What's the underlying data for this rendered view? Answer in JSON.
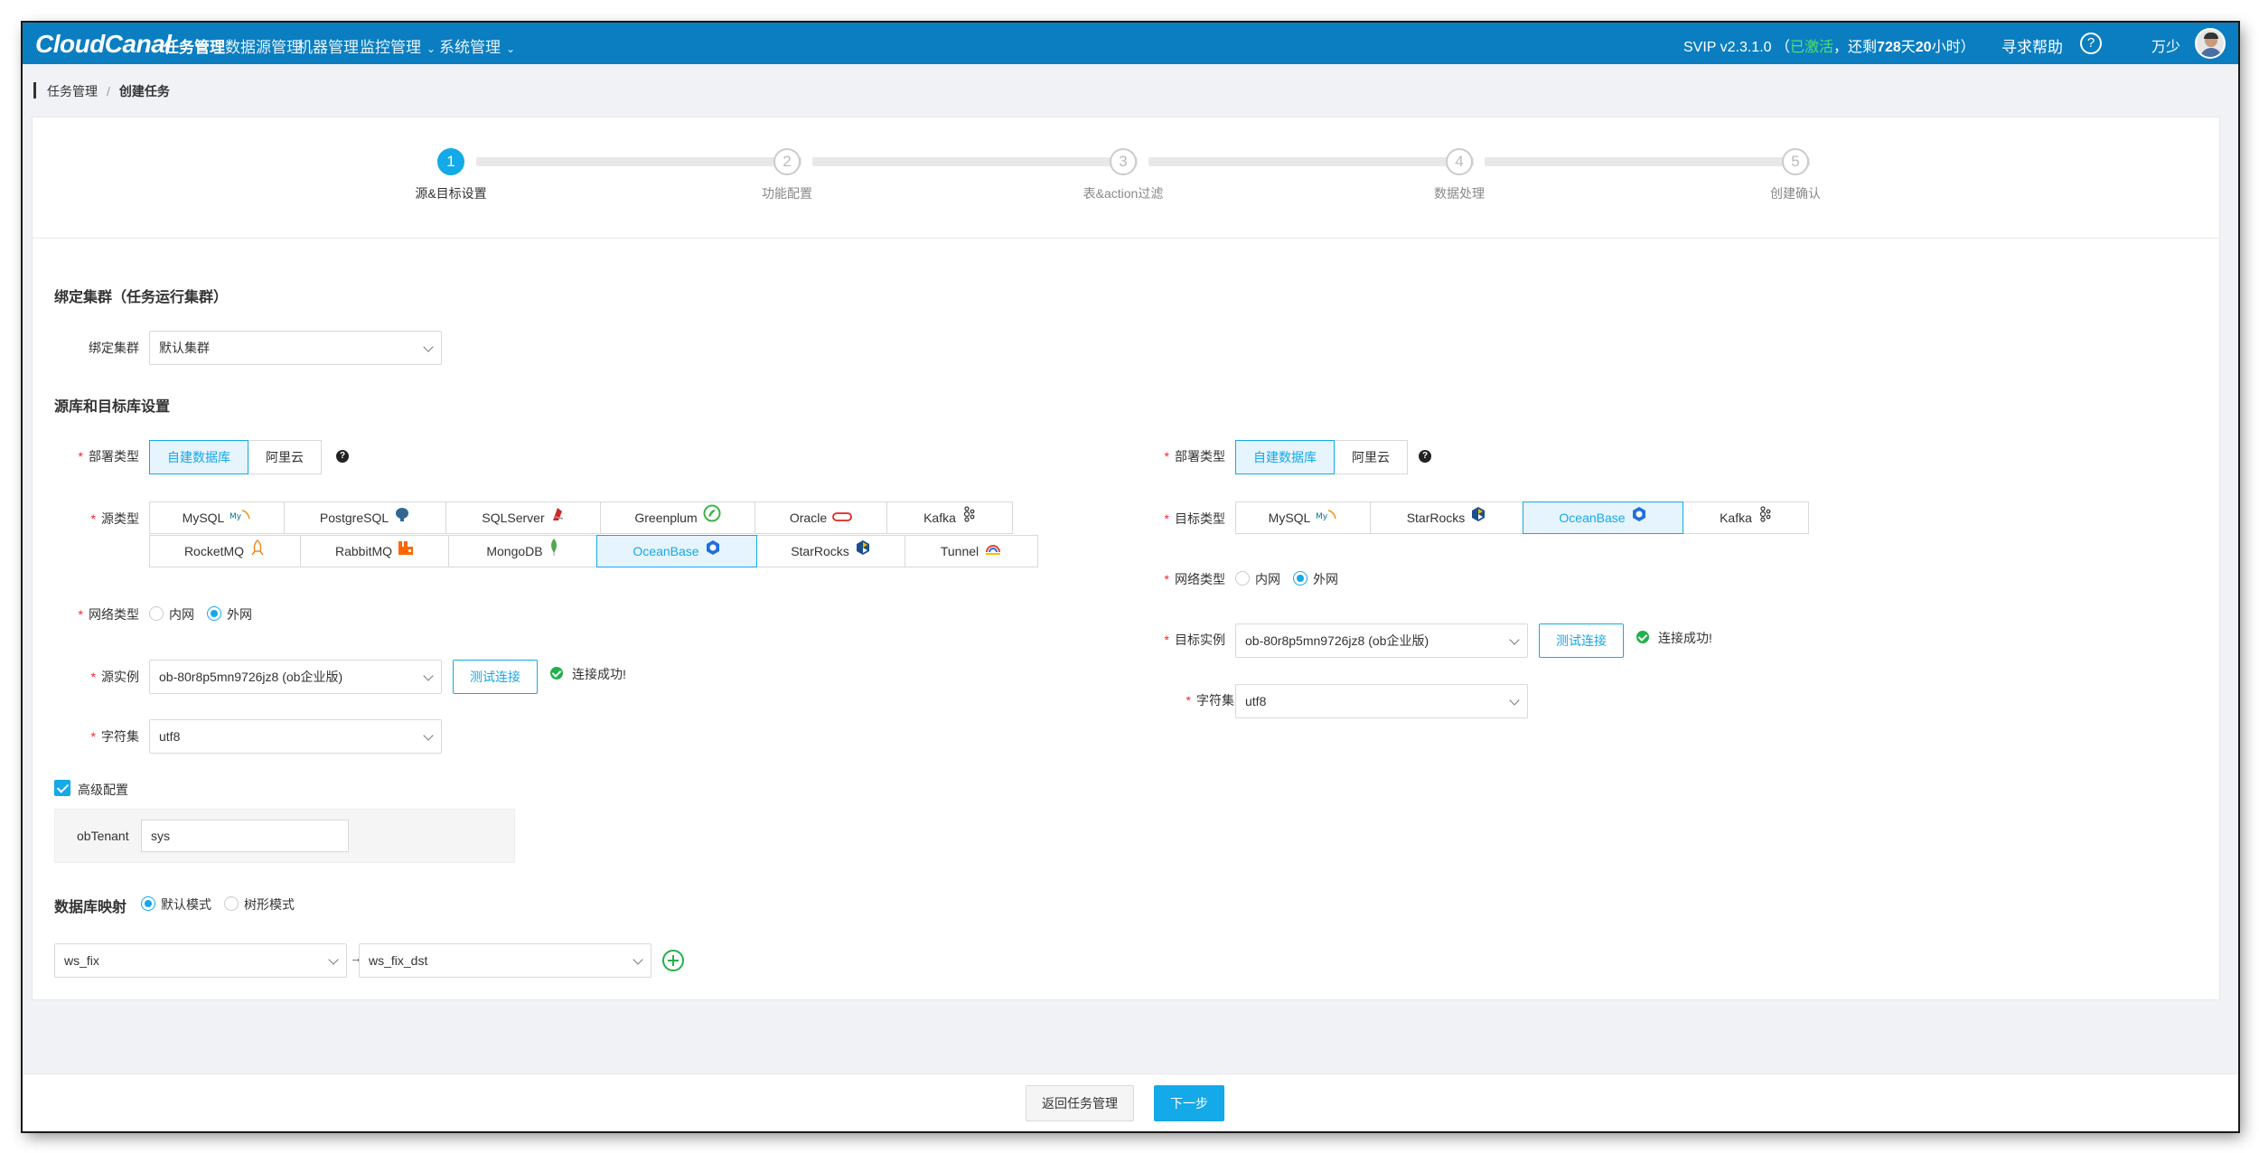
{
  "app": {
    "logo": "CloudCanal",
    "nav": [
      {
        "label": "任务管理",
        "active": true
      },
      {
        "label": "数据源管理"
      },
      {
        "label": "机器管理"
      },
      {
        "label": "监控管理"
      },
      {
        "label": "系统管理"
      }
    ],
    "version": "SVIP v2.3.1.0",
    "activation": {
      "open": "（",
      "status": "已激活",
      "comma": "，还剩",
      "days": "728",
      "days_unit": "天",
      "hours": "20",
      "hours_unit": "小时）"
    },
    "help": "寻求帮助",
    "help_icon": "?",
    "user": "万少",
    "colors": {
      "nav_bg": "#0a7ec1",
      "accent": "#14a9e8",
      "success": "#21b14a",
      "required": "#f5222d"
    }
  },
  "breadcrumb": {
    "root": "任务管理",
    "sep": "/",
    "current": "创建任务"
  },
  "steps": [
    {
      "num": "1",
      "label": "源&目标设置",
      "active": true
    },
    {
      "num": "2",
      "label": "功能配置"
    },
    {
      "num": "3",
      "label": "表&action过滤"
    },
    {
      "num": "4",
      "label": "数据处理"
    },
    {
      "num": "5",
      "label": "创建确认"
    }
  ],
  "cluster": {
    "section_title": "绑定集群（任务运行集群）",
    "label": "绑定集群",
    "value": "默认集群"
  },
  "db_settings": {
    "section_title": "源库和目标库设置"
  },
  "source": {
    "deploy_label": "部署类型",
    "deploy_options": [
      "自建数据库",
      "阿里云"
    ],
    "deploy_selected": "自建数据库",
    "type_label": "源类型",
    "types_row1": [
      {
        "name": "MySQL",
        "icon": "mysql-icon"
      },
      {
        "name": "PostgreSQL",
        "icon": "postgresql-icon"
      },
      {
        "name": "SQLServer",
        "icon": "sqlserver-icon"
      },
      {
        "name": "Greenplum",
        "icon": "greenplum-icon"
      },
      {
        "name": "Oracle",
        "icon": "oracle-icon"
      },
      {
        "name": "Kafka",
        "icon": "kafka-icon"
      }
    ],
    "types_row2": [
      {
        "name": "RocketMQ",
        "icon": "rocketmq-icon"
      },
      {
        "name": "RabbitMQ",
        "icon": "rabbitmq-icon"
      },
      {
        "name": "MongoDB",
        "icon": "mongodb-icon"
      },
      {
        "name": "OceanBase",
        "icon": "oceanbase-icon",
        "selected": true
      },
      {
        "name": "StarRocks",
        "icon": "starrocks-icon"
      },
      {
        "name": "Tunnel",
        "icon": "tunnel-icon"
      }
    ],
    "network_label": "网络类型",
    "network_options": [
      "内网",
      "外网"
    ],
    "network_selected": "外网",
    "instance_label": "源实例",
    "instance_value": "ob-80r8p5mn9726jz8 (ob企业版)",
    "test_button": "测试连接",
    "test_result": "连接成功!",
    "charset_label": "字符集",
    "charset_value": "utf8"
  },
  "target": {
    "deploy_label": "部署类型",
    "deploy_options": [
      "自建数据库",
      "阿里云"
    ],
    "deploy_selected": "自建数据库",
    "type_label": "目标类型",
    "types": [
      {
        "name": "MySQL",
        "icon": "mysql-icon"
      },
      {
        "name": "StarRocks",
        "icon": "starrocks-icon"
      },
      {
        "name": "OceanBase",
        "icon": "oceanbase-icon",
        "selected": true
      },
      {
        "name": "Kafka",
        "icon": "kafka-icon"
      }
    ],
    "network_label": "网络类型",
    "network_options": [
      "内网",
      "外网"
    ],
    "network_selected": "外网",
    "instance_label": "目标实例",
    "instance_value": "ob-80r8p5mn9726jz8 (ob企业版)",
    "test_button": "测试连接",
    "test_result": "连接成功!",
    "charset_label": "字符集",
    "charset_value": "utf8"
  },
  "advanced": {
    "checkbox_label": "高级配置",
    "checked": true,
    "tenant_label": "obTenant",
    "tenant_value": "sys"
  },
  "mapping": {
    "section_title": "数据库映射",
    "modes": [
      "默认模式",
      "树形模式"
    ],
    "mode_selected": "默认模式",
    "source_db": "ws_fix",
    "arrow": "→",
    "target_db": "ws_fix_dst"
  },
  "footer": {
    "back_button": "返回任务管理",
    "next_button": "下一步"
  }
}
